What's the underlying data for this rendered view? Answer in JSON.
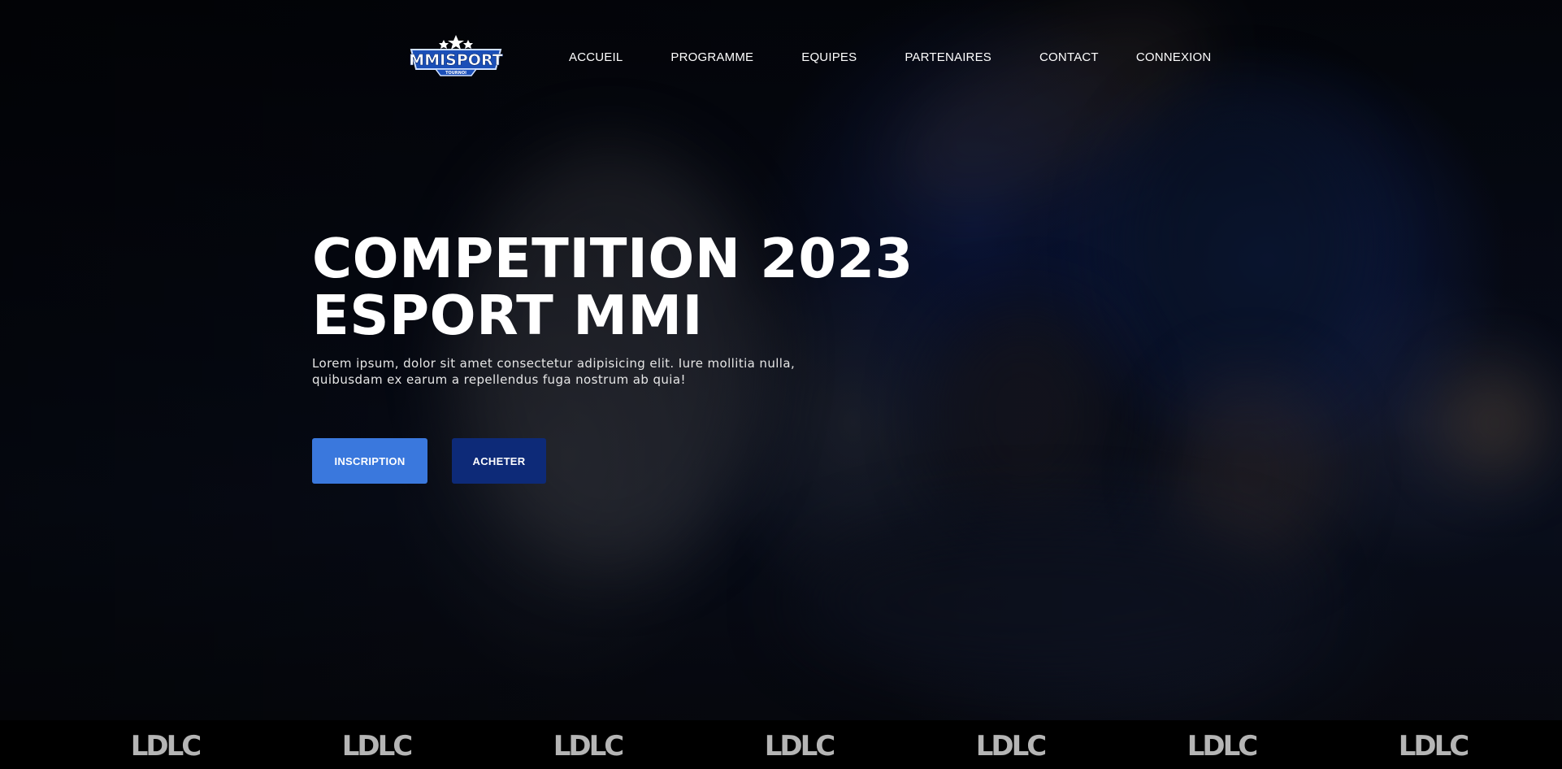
{
  "header": {
    "logo": {
      "text": "MMISPORT",
      "subtext": "TOURNOI",
      "icon": "star-shield-logo"
    },
    "nav": [
      {
        "label": "ACCUEIL"
      },
      {
        "label": "PROGRAMME"
      },
      {
        "label": "EQUIPES"
      },
      {
        "label": "PARTENAIRES"
      },
      {
        "label": "CONTACT"
      },
      {
        "label": "CONNEXION"
      }
    ]
  },
  "hero": {
    "title_line1": "COMPETITION 2023",
    "title_line2": "ESPORT MMI",
    "description": "Lorem ipsum, dolor sit amet consectetur adipisicing elit. Iure mollitia nulla, quibusdam ex earum a repellendus fuga nostrum ab quia!",
    "buttons": {
      "inscription": "INSCRIPTION",
      "acheter": "ACHETER"
    }
  },
  "sponsors": [
    {
      "name": "LDLC"
    },
    {
      "name": "LDLC"
    },
    {
      "name": "LDLC"
    },
    {
      "name": "LDLC"
    },
    {
      "name": "LDLC"
    },
    {
      "name": "LDLC"
    },
    {
      "name": "LDLC"
    }
  ],
  "colors": {
    "primary_button": "#3a78dd",
    "secondary_button": "#0d2a78",
    "sponsor_strip": "#000000",
    "sponsor_logo": "#b5b5b5"
  }
}
